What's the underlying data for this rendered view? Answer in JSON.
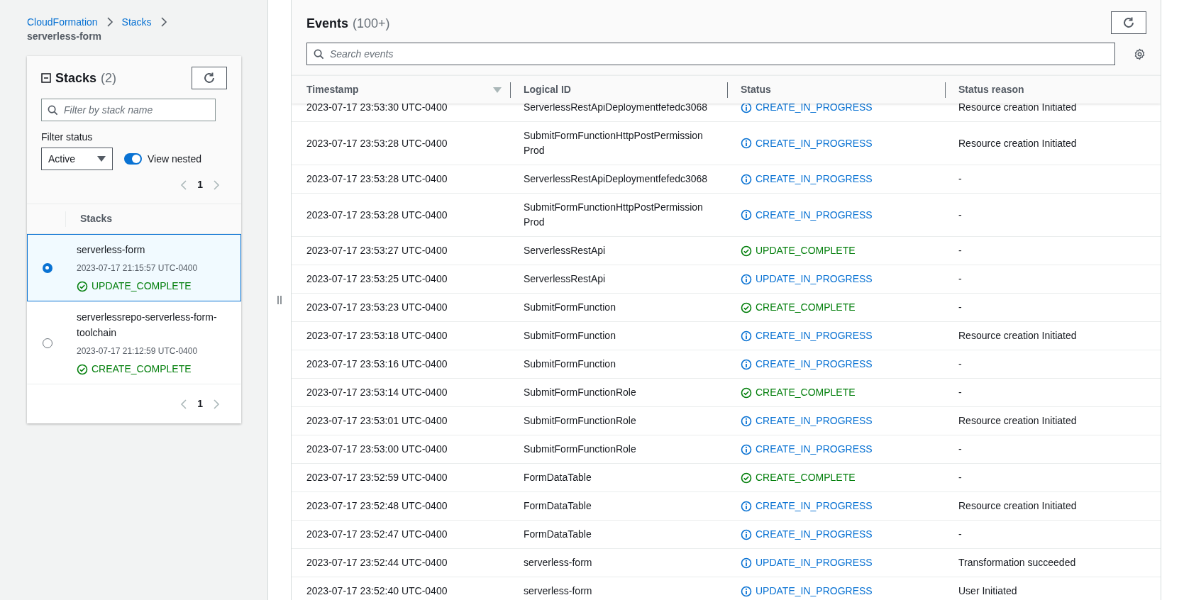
{
  "breadcrumbs": [
    {
      "label": "CloudFormation",
      "link": true
    },
    {
      "label": "Stacks",
      "link": true
    },
    {
      "label": "serverless-form",
      "link": false
    }
  ],
  "stacks_panel": {
    "title": "Stacks",
    "count": "(2)",
    "search": {
      "placeholder": "Filter by stack name"
    },
    "filter_label": "Filter status",
    "filter_value": "Active",
    "view_nested": {
      "label": "View nested",
      "on": true
    },
    "page": "1",
    "column": "Stacks",
    "items": [
      {
        "name": "serverless-form",
        "time": "2023-07-17 21:15:57 UTC-0400",
        "status": {
          "kind": "success",
          "text": "UPDATE_COMPLETE"
        },
        "selected": true
      },
      {
        "name": "serverlessrepo-serverless-form-toolchain",
        "time": "2023-07-17 21:12:59 UTC-0400",
        "status": {
          "kind": "success",
          "text": "CREATE_COMPLETE"
        },
        "selected": false
      }
    ],
    "footer_page": "1"
  },
  "events": {
    "title": "Events",
    "count": "(100+)",
    "search": {
      "placeholder": "Search events"
    },
    "columns": [
      "Timestamp",
      "Logical ID",
      "Status",
      "Status reason"
    ],
    "rows": [
      {
        "timestamp": "2023-07-17 23:53:30 UTC-0400",
        "logical_id": "ServerlessRestApiDeploymentfefedc3068",
        "status": {
          "kind": "info",
          "text": "CREATE_IN_PROGRESS"
        },
        "reason": "Resource creation Initiated"
      },
      {
        "timestamp": "2023-07-17 23:53:28 UTC-0400",
        "logical_id": "SubmitFormFunctionHttpPostPermission Prod",
        "status": {
          "kind": "info",
          "text": "CREATE_IN_PROGRESS"
        },
        "reason": "Resource creation Initiated"
      },
      {
        "timestamp": "2023-07-17 23:53:28 UTC-0400",
        "logical_id": "ServerlessRestApiDeploymentfefedc3068",
        "status": {
          "kind": "info",
          "text": "CREATE_IN_PROGRESS"
        },
        "reason": "-"
      },
      {
        "timestamp": "2023-07-17 23:53:28 UTC-0400",
        "logical_id": "SubmitFormFunctionHttpPostPermission Prod",
        "status": {
          "kind": "info",
          "text": "CREATE_IN_PROGRESS"
        },
        "reason": "-"
      },
      {
        "timestamp": "2023-07-17 23:53:27 UTC-0400",
        "logical_id": "ServerlessRestApi",
        "status": {
          "kind": "success",
          "text": "UPDATE_COMPLETE"
        },
        "reason": "-"
      },
      {
        "timestamp": "2023-07-17 23:53:25 UTC-0400",
        "logical_id": "ServerlessRestApi",
        "status": {
          "kind": "info",
          "text": "UPDATE_IN_PROGRESS"
        },
        "reason": "-"
      },
      {
        "timestamp": "2023-07-17 23:53:23 UTC-0400",
        "logical_id": "SubmitFormFunction",
        "status": {
          "kind": "success",
          "text": "CREATE_COMPLETE"
        },
        "reason": "-"
      },
      {
        "timestamp": "2023-07-17 23:53:18 UTC-0400",
        "logical_id": "SubmitFormFunction",
        "status": {
          "kind": "info",
          "text": "CREATE_IN_PROGRESS"
        },
        "reason": "Resource creation Initiated"
      },
      {
        "timestamp": "2023-07-17 23:53:16 UTC-0400",
        "logical_id": "SubmitFormFunction",
        "status": {
          "kind": "info",
          "text": "CREATE_IN_PROGRESS"
        },
        "reason": "-"
      },
      {
        "timestamp": "2023-07-17 23:53:14 UTC-0400",
        "logical_id": "SubmitFormFunctionRole",
        "status": {
          "kind": "success",
          "text": "CREATE_COMPLETE"
        },
        "reason": "-"
      },
      {
        "timestamp": "2023-07-17 23:53:01 UTC-0400",
        "logical_id": "SubmitFormFunctionRole",
        "status": {
          "kind": "info",
          "text": "CREATE_IN_PROGRESS"
        },
        "reason": "Resource creation Initiated"
      },
      {
        "timestamp": "2023-07-17 23:53:00 UTC-0400",
        "logical_id": "SubmitFormFunctionRole",
        "status": {
          "kind": "info",
          "text": "CREATE_IN_PROGRESS"
        },
        "reason": "-"
      },
      {
        "timestamp": "2023-07-17 23:52:59 UTC-0400",
        "logical_id": "FormDataTable",
        "status": {
          "kind": "success",
          "text": "CREATE_COMPLETE"
        },
        "reason": "-"
      },
      {
        "timestamp": "2023-07-17 23:52:48 UTC-0400",
        "logical_id": "FormDataTable",
        "status": {
          "kind": "info",
          "text": "CREATE_IN_PROGRESS"
        },
        "reason": "Resource creation Initiated"
      },
      {
        "timestamp": "2023-07-17 23:52:47 UTC-0400",
        "logical_id": "FormDataTable",
        "status": {
          "kind": "info",
          "text": "CREATE_IN_PROGRESS"
        },
        "reason": "-"
      },
      {
        "timestamp": "2023-07-17 23:52:44 UTC-0400",
        "logical_id": "serverless-form",
        "status": {
          "kind": "info",
          "text": "UPDATE_IN_PROGRESS"
        },
        "reason": "Transformation succeeded"
      },
      {
        "timestamp": "2023-07-17 23:52:40 UTC-0400",
        "logical_id": "serverless-form",
        "status": {
          "kind": "info",
          "text": "UPDATE_IN_PROGRESS"
        },
        "reason": "User Initiated"
      }
    ]
  }
}
